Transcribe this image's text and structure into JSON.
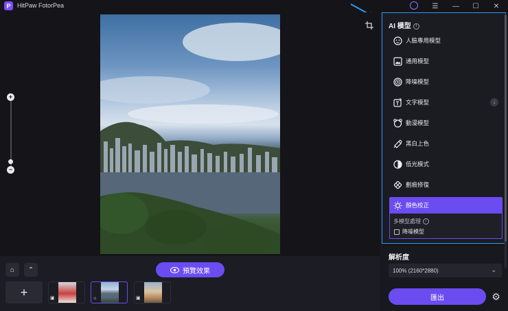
{
  "app": {
    "title": "HitPaw FotorPea",
    "logo_letter": "P"
  },
  "window_controls": {
    "menu": "☰",
    "minimize": "—",
    "maximize": "☐",
    "close": "✕"
  },
  "toolbar": {
    "crop_icon": "crop-icon"
  },
  "zoom": {
    "plus": "+",
    "minus": "−"
  },
  "bottom": {
    "home_icon": "⌂",
    "collapse_icon": "⌃",
    "preview_label": "預覽效果",
    "add_label": "+"
  },
  "right_panel": {
    "ai_models_title": "AI 模型",
    "models": [
      {
        "label": "人臉專用模型",
        "icon": "face-icon"
      },
      {
        "label": "通用模型",
        "icon": "image-icon"
      },
      {
        "label": "降噪模型",
        "icon": "noise-icon"
      },
      {
        "label": "文字模型",
        "icon": "text-icon"
      },
      {
        "label": "動漫模型",
        "icon": "anime-icon"
      },
      {
        "label": "黑白上色",
        "icon": "colorize-icon"
      },
      {
        "label": "低光模式",
        "icon": "lowlight-icon"
      },
      {
        "label": "劃痕修復",
        "icon": "scratch-icon"
      },
      {
        "label": "顏色校正",
        "icon": "color-correct-icon"
      }
    ],
    "multi_model_title": "多模型處理",
    "multi_model_option": "降噪模型",
    "resolution_title": "解析度",
    "resolution_value": "100% (2160*2880)",
    "export_label": "匯出"
  },
  "colors": {
    "accent": "#6b4cf0",
    "highlight_border": "#2e9bf0",
    "background": "#141419"
  }
}
